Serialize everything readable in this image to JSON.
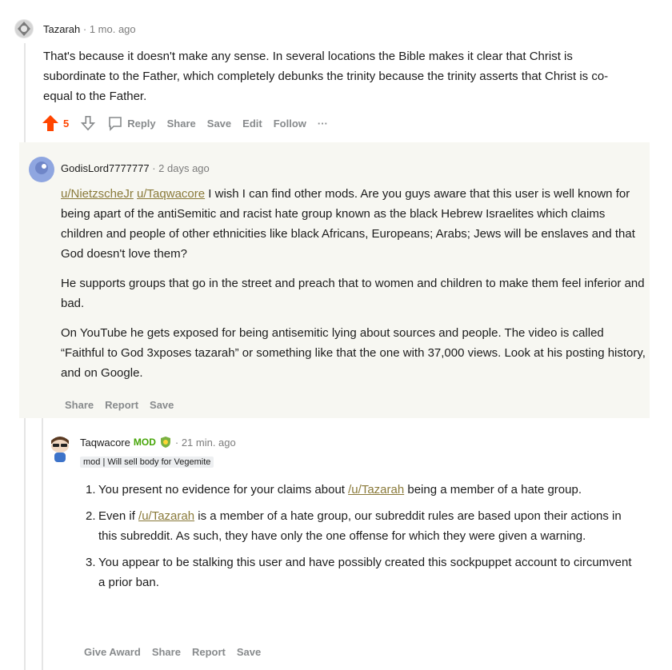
{
  "comment1": {
    "username": "Tazarah",
    "time": "· 1 mo. ago",
    "text": "That's because it doesn't make any sense. In several locations the Bible makes it clear that Christ is subordinate to the Father, which completely debunks the trinity because the trinity asserts that Christ is co-equal to the Father.",
    "score": "5",
    "actions": {
      "reply": "Reply",
      "share": "Share",
      "save": "Save",
      "edit": "Edit",
      "follow": "Follow",
      "more": "···"
    }
  },
  "comment2": {
    "username": "GodisLord7777777",
    "time": "· 2 days ago",
    "mention1": "u/NietzscheJr",
    "mention2": "u/Taqwacore",
    "para1_rest": "I wish I can find other mods. Are you guys aware that this user is well known for being apart of the antiSemitic and racist hate group known as the black Hebrew Israelites which claims children and people of other ethnicities like black Africans, Europeans; Arabs; Jews will be enslaves and that God doesn't love them?",
    "para2": "He supports groups that go in the street and preach that to women and children to make them feel inferior and bad.",
    "para3": "On YouTube he gets exposed for being antisemitic lying about sources and people. The video is called “Faithful to God 3xposes tazarah” or something like that the one with 37,000 views. Look at his posting history, and on Google.",
    "actions": {
      "share": "Share",
      "report": "Report",
      "save": "Save"
    }
  },
  "comment3": {
    "username": "Taqwacore",
    "mod": "MOD",
    "time": "· 21 min. ago",
    "flair": "mod | Will sell body for Vegemite",
    "items": [
      {
        "num": "1.",
        "before": "You present no evidence for your claims about ",
        "link": "/u/Tazarah",
        "after": " being a member of a hate group."
      },
      {
        "num": "2.",
        "before": "Even if ",
        "link": "/u/Tazarah",
        "after": " is a member of a hate group, our subreddit rules are based upon their actions in this subreddit. As such, they have only the one offense for which they were given a warning."
      },
      {
        "num": "3.",
        "before": "You appear to be stalking this user and have possibly created this sockpuppet account to circumvent a prior ban.",
        "link": "",
        "after": ""
      }
    ],
    "actions": {
      "award": "Give Award",
      "share": "Share",
      "report": "Report",
      "save": "Save"
    }
  },
  "colors": {
    "upvote": "#ff4500",
    "link": "#8a7a3a",
    "mod": "#46a508",
    "highlight": "#f7f7f2"
  }
}
